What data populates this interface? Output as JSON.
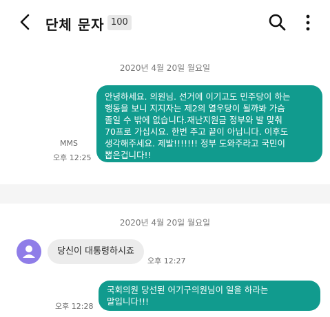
{
  "header": {
    "title": "단체 문자",
    "count": "100"
  },
  "messages_top": {
    "date": "2020년 4월 20일 월요일",
    "message": {
      "text": "안녕하세요. 의원님. 선거에 이기고도 민주당이 하는\n행동을 보니 지지자는 제2의 열우당이 될까봐 가슴\n졸일 수 밖에 없습니다.재난지원금 정부와 발 맞춰\n70프로 가십시요. 한번 주고 끝이 아닙니다. 이후도\n생각해주세요. 제발!!!!!!! 정부 도와주라고 국민이\n뽑은겁니다!!",
      "type": "MMS",
      "time": "오후 12:25"
    }
  },
  "messages_bottom": {
    "date": "2020년 4월 20일 월요일",
    "received": {
      "text": "당신이 대통령하시죠",
      "time": "오후 12:27"
    },
    "sent": {
      "text": "국회의원 당선된 어기구의원님이 일을 하라는\n말입니다!!!",
      "time": "오후 12:28"
    }
  },
  "colors": {
    "sent_bubble": "#119b8e",
    "received_bubble": "#ececec",
    "avatar": "#8f7de8"
  }
}
